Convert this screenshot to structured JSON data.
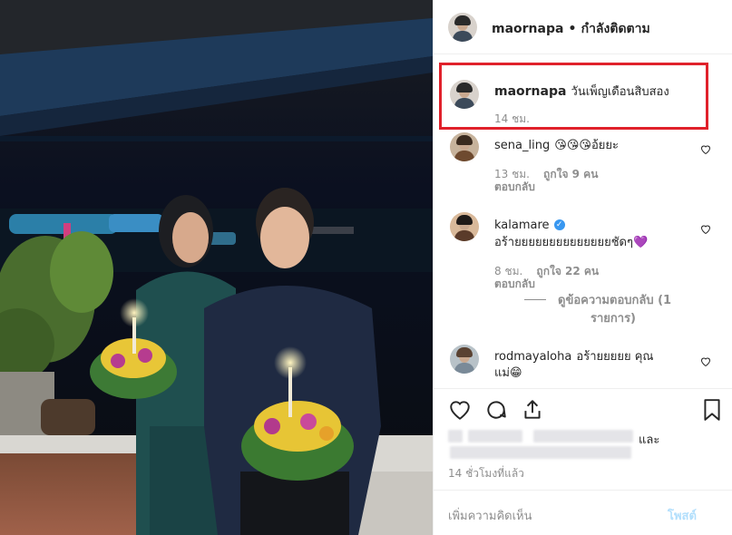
{
  "header": {
    "username": "maornapa",
    "separator": "•",
    "follow_status": "กำลังติดตาม"
  },
  "caption": {
    "username": "maornapa",
    "text": "วันเพ็ญเดือนสิบสอง",
    "time": "14 ชม."
  },
  "comments": [
    {
      "username": "sena_ling",
      "text": "😘😘😘อ้ยยะ",
      "time": "13 ชม.",
      "likes": "ถูกใจ 9 คน",
      "reply": "ตอบกลับ"
    },
    {
      "username": "kalamare",
      "verified": true,
      "text": "อร้ายยยยยยยยยยยยยยชัดๆ💜",
      "time": "8 ชม.",
      "likes": "ถูกใจ 22 คน",
      "reply": "ตอบกลับ",
      "view_replies_line1": "ดูข้อความตอบกลับ (1",
      "view_replies_line2": "รายการ)"
    },
    {
      "username": "rodmayaloha",
      "text_line1": "อร้ายยยยย คุณ",
      "text_line2": "แม่😁"
    }
  ],
  "likes_summary": {
    "and": "และ",
    "posted_time": "14 ชั่วโมงที่แล้ว"
  },
  "add_comment": {
    "placeholder": "เพิ่มความคิดเห็น",
    "post_label": "โพสต์"
  },
  "colors": {
    "highlight": "#e0212b",
    "verified": "#3897f0",
    "text": "#262626",
    "muted": "#8e8e8e"
  },
  "icons": {
    "like": "heart-icon",
    "comment": "comment-icon",
    "share": "share-icon",
    "save": "bookmark-icon"
  }
}
